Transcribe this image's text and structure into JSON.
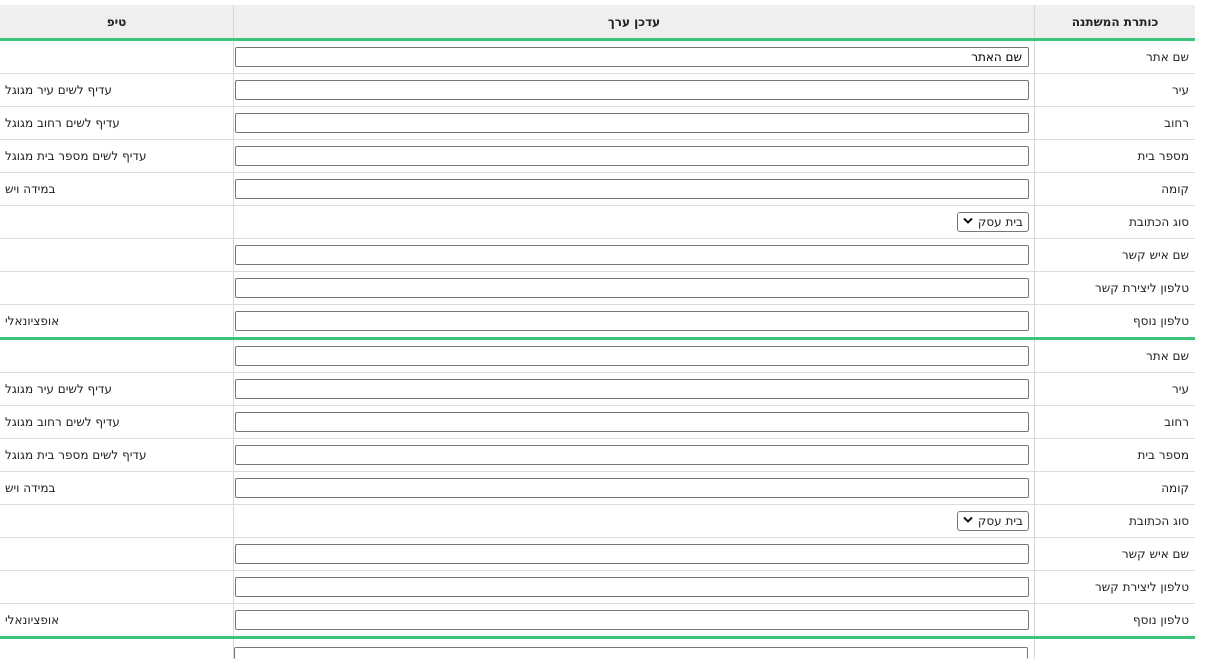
{
  "header": {
    "variable_title": "כותרת המשתנה",
    "edit_value": "עדכן ערך",
    "tip": "טיפ"
  },
  "groups": [
    {
      "rows": [
        {
          "label": "שם אתר",
          "value": "שם האתר",
          "tip": ""
        },
        {
          "label": "עיר",
          "value": "",
          "tip": "עדיף לשים עיר מגוגל"
        },
        {
          "label": "רחוב",
          "value": "",
          "tip": "עדיף לשים רחוב מגוגל"
        },
        {
          "label": "מספר בית",
          "value": "",
          "tip": "עדיף לשים מספר בית מגוגל"
        },
        {
          "label": "קומה",
          "value": "",
          "tip": "במידה ויש"
        },
        {
          "label": "סוג הכתובת",
          "select": "בית עסק",
          "tip": ""
        },
        {
          "label": "שם איש קשר",
          "value": "",
          "tip": ""
        },
        {
          "label": "טלפון ליצירת קשר",
          "value": "",
          "tip": ""
        },
        {
          "label": "טלפון נוסף",
          "value": "",
          "tip": "אופציונאלי"
        }
      ]
    },
    {
      "rows": [
        {
          "label": "שם אתר",
          "value": "",
          "tip": ""
        },
        {
          "label": "עיר",
          "value": "",
          "tip": "עדיף לשים עיר מגוגל"
        },
        {
          "label": "רחוב",
          "value": "",
          "tip": "עדיף לשים רחוב מגוגל"
        },
        {
          "label": "מספר בית",
          "value": "",
          "tip": "עדיף לשים מספר בית מגוגל"
        },
        {
          "label": "קומה",
          "value": "",
          "tip": "במידה ויש"
        },
        {
          "label": "סוג הכתובת",
          "select": "בית עסק",
          "tip": ""
        },
        {
          "label": "שם איש קשר",
          "value": "",
          "tip": ""
        },
        {
          "label": "טלפון ליצירת קשר",
          "value": "",
          "tip": ""
        },
        {
          "label": "טלפון נוסף",
          "value": "",
          "tip": "אופציונאלי"
        }
      ]
    }
  ],
  "icons": {
    "select_arrow": "chevron-down-icon"
  }
}
